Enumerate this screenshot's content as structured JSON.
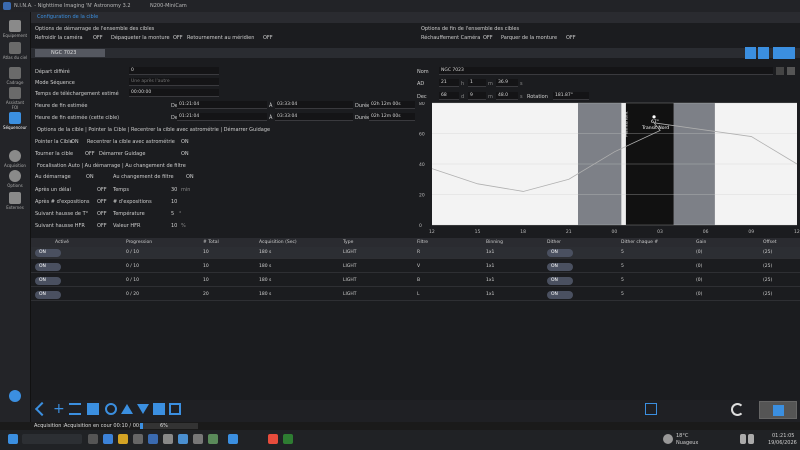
{
  "titlebar": {
    "app": "N.I.N.A. - Nighttime Imaging 'N' Astronomy 3.2",
    "camera": "N200-MiniCam"
  },
  "sidebar": {
    "items": [
      {
        "label": "Equipement"
      },
      {
        "label": "Atlas du ciel"
      },
      {
        "label": "Cadrage"
      },
      {
        "label": "Assistant FOI"
      },
      {
        "label": "Séquenceur"
      },
      {
        "label": "Acquisition"
      },
      {
        "label": "Options"
      },
      {
        "label": "Externes"
      }
    ]
  },
  "tab": {
    "title": "Configuration de la cible"
  },
  "start_options": {
    "title": "Options de démarrage de l'ensemble des cibles",
    "cool_camera": "Refroidir la caméra",
    "cool_camera_state": "OFF",
    "unpark_mount": "Dépaqueter la monture",
    "unpark_mount_state": "OFF",
    "meridian": "Retournement au méridien",
    "meridian_state": "OFF"
  },
  "end_options": {
    "title": "Options de fin de l'ensemble des cibles",
    "warm_camera": "Réchauffement Caméra",
    "warm_camera_state": "OFF",
    "park_mount": "Parquer de la monture",
    "park_mount_state": "OFF"
  },
  "target_tab": "NGC 7023",
  "left_form": {
    "delayed_start": "Départ différé",
    "delayed_start_value": "0",
    "seq_mode": "Mode Séquence",
    "seq_mode_value": "Une après l'autre",
    "dl_time": "Temps de téléchargement estimé",
    "dl_time_value": "00:00:00",
    "end_est": "Heure de fin estimée",
    "end_est_from": "01:21:04",
    "end_est_to": "03:33:04",
    "end_est_dur": "02h 12m 00s",
    "end_est_target": "Heure de fin estimée (cette cible)",
    "end_est_target_from": "01:21:04",
    "end_est_target_to": "03:33:04",
    "end_est_target_dur": "02h 12m 00s",
    "de": "De",
    "a": "À",
    "duree": "Durée"
  },
  "target_options": {
    "title": "Options de la cible | Pointer la Cible | Recentrer la cible avec astrométrie | Démarrer Guidage",
    "point": "Pointer la Cible",
    "point_state": "ON",
    "recenter": "Recentrer la cible avec astrométrie",
    "recenter_state": "ON",
    "rotate": "Tourner la cible",
    "rotate_state": "OFF",
    "guide": "Démarrer Guidage",
    "guide_state": "ON"
  },
  "autofocus": {
    "title": "Focalisation Auto | Au démarrage | Au changement de filtre",
    "at_start": "Au démarrage",
    "at_start_state": "ON",
    "filter_change": "Au changement de filtre",
    "filter_change_state": "ON",
    "after_delay": "Après un délai",
    "after_delay_state": "OFF",
    "time": "Temps",
    "time_value": "30",
    "time_unit": "min",
    "after_exposures": "Après # d'expositions",
    "after_exposures_state": "OFF",
    "nexp": "# d'expositions",
    "nexp_value": "10",
    "temp_rise": "Suivant hausse de T°",
    "temp_rise_state": "OFF",
    "temp": "Température",
    "temp_value": "5",
    "temp_unit": "°",
    "hfr_rise": "Suivant hausse HFR",
    "hfr_rise_state": "OFF",
    "hfr": "Valeur HFR",
    "hfr_value": "10",
    "hfr_unit": "%"
  },
  "coords": {
    "name_label": "Nom",
    "name": "NGC 7023",
    "ra_label": "AD",
    "ra_h": "21",
    "ra_h_unit": "h",
    "ra_m": "1",
    "ra_m_unit": "m",
    "ra_s": "36.9",
    "ra_s_unit": "s",
    "dec_label": "Dec",
    "dec_d": "68",
    "dec_d_unit": "d",
    "dec_m": "9",
    "dec_m_unit": "m",
    "dec_s": "48.0",
    "dec_s_unit": "s",
    "rotation_label": "Rotation",
    "rotation": "181.87°"
  },
  "chart_data": {
    "type": "line",
    "x_ticks": [
      "12",
      "15",
      "18",
      "21",
      "00",
      "03",
      "06",
      "09",
      "12"
    ],
    "y_ticks": [
      "0",
      "20",
      "40",
      "60",
      "80"
    ],
    "ylim": [
      0,
      80
    ],
    "now_label": "Maintenant",
    "transit_label": "Transit Nord",
    "transit_alt": "67°",
    "altitude_curve": {
      "x_hours": [
        12,
        15,
        18,
        21,
        0,
        3,
        5.6,
        9,
        12
      ],
      "y": [
        37,
        27,
        22,
        30,
        48,
        62,
        67,
        58,
        40
      ]
    }
  },
  "table": {
    "headers": [
      "Activé",
      "Progression",
      "# Total",
      "Acquisition (Sec)",
      "Type",
      "Filtre",
      "Binning",
      "Dither",
      "Dither chaque #",
      "Gain",
      "Offset"
    ],
    "rows": [
      {
        "enabled": "ON",
        "progress": "0 / 10",
        "total": "10",
        "exposure": "180 s",
        "type": "LIGHT",
        "filter": "R",
        "binning": "1x1",
        "dither": "ON",
        "dither_every": "5",
        "gain": "(0)",
        "offset": "(25)"
      },
      {
        "enabled": "ON",
        "progress": "0 / 10",
        "total": "10",
        "exposure": "180 s",
        "type": "LIGHT",
        "filter": "V",
        "binning": "1x1",
        "dither": "ON",
        "dither_every": "5",
        "gain": "(0)",
        "offset": "(25)"
      },
      {
        "enabled": "ON",
        "progress": "0 / 10",
        "total": "10",
        "exposure": "180 s",
        "type": "LIGHT",
        "filter": "B",
        "binning": "1x1",
        "dither": "ON",
        "dither_every": "5",
        "gain": "(0)",
        "offset": "(25)"
      },
      {
        "enabled": "ON",
        "progress": "0 / 20",
        "total": "20",
        "exposure": "180 s",
        "type": "LIGHT",
        "filter": "L",
        "binning": "1x1",
        "dither": "ON",
        "dither_every": "5",
        "gain": "(0)",
        "offset": "(25)"
      }
    ]
  },
  "status": {
    "label": "Acquisition :",
    "text": "Acquisition en cour 00:10 / 00:00",
    "progress_pct": "6%",
    "progress": 0.06
  },
  "taskbar": {
    "weather_temp": "18°C",
    "weather_desc": "Nuageux",
    "time": "01:21:05",
    "date": "19/06/2026"
  },
  "colors": {
    "accent": "#3b8fe0",
    "bg": "#1b1c1f"
  }
}
